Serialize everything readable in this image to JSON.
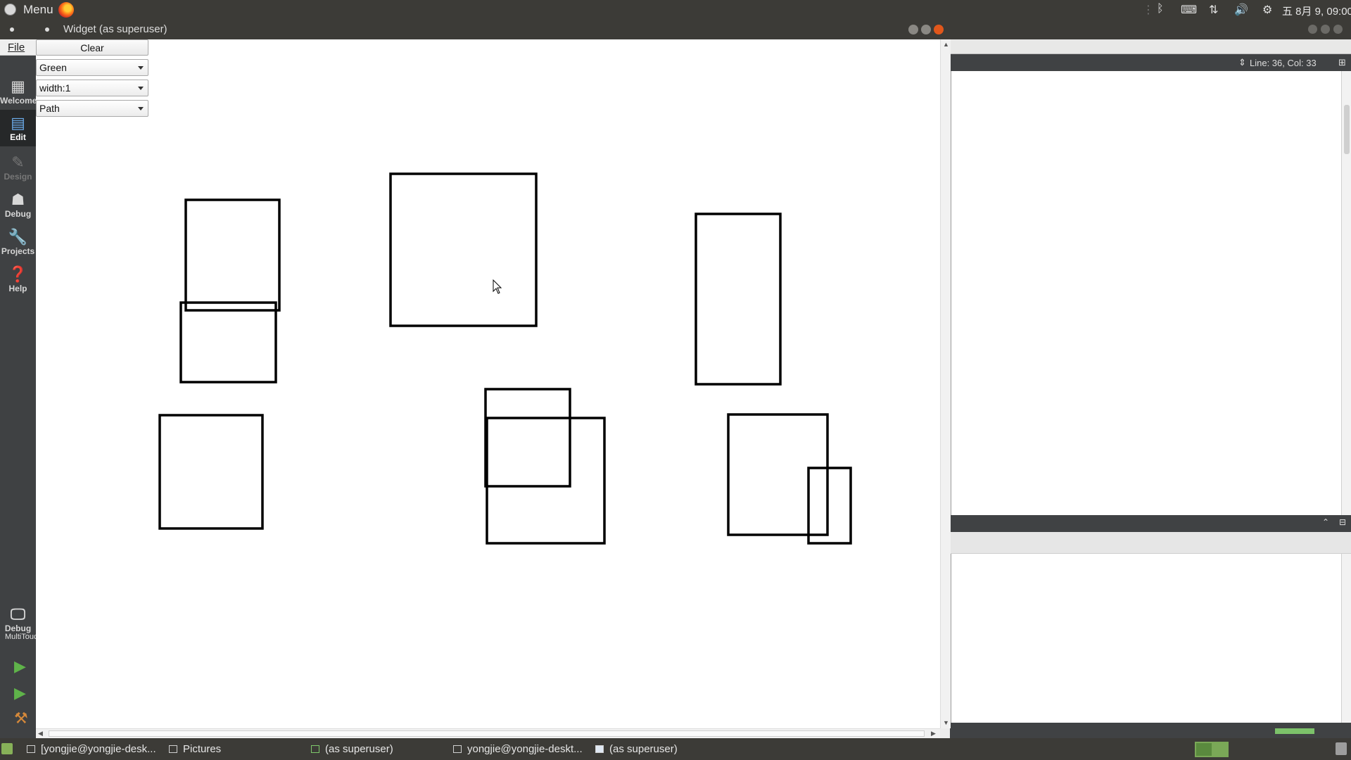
{
  "top_panel": {
    "menu_label": "Menu",
    "clock": "五 8月 9, 09:00"
  },
  "widget_window": {
    "title": "Widget (as superuser)",
    "controls": {
      "clear_label": "Clear",
      "color_value": "Green",
      "width_value": "width:1",
      "shape_value": "Path"
    }
  },
  "creator": {
    "file_menu": "File",
    "line_col": "Line: 36, Col: 33",
    "modes": [
      {
        "label": "Welcome",
        "icon": "grid-icon"
      },
      {
        "label": "Edit",
        "icon": "edit-icon"
      },
      {
        "label": "Design",
        "icon": "pen-icon"
      },
      {
        "label": "Debug",
        "icon": "bug-icon"
      },
      {
        "label": "Projects",
        "icon": "wrench-icon"
      },
      {
        "label": "Help",
        "icon": "help-icon"
      }
    ],
    "kit_label": "MultiTouch",
    "kit_mode_label": "Debug"
  },
  "taskbar": {
    "tasks": [
      {
        "label": "[yongjie@yongjie-desk...",
        "icon": "terminal-icon"
      },
      {
        "label": "Pictures",
        "icon": "folder-icon"
      },
      {
        "label": "(as superuser)",
        "icon": "qt-icon"
      },
      {
        "label": "yongjie@yongjie-deskt...",
        "icon": "terminal-icon"
      },
      {
        "label": "(as superuser)",
        "icon": "window-icon"
      }
    ]
  },
  "colors": {
    "panel_bg": "#3c3b37",
    "canvas_bg": "#ffffff",
    "stroke": "#000000",
    "accent_green": "#87b158"
  }
}
